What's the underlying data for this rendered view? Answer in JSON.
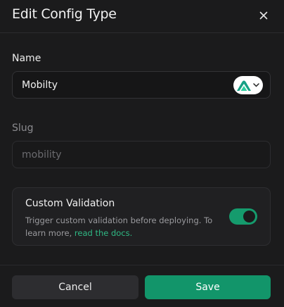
{
  "header": {
    "title": "Edit Config Type",
    "close_icon": "close-icon"
  },
  "form": {
    "name": {
      "label": "Name",
      "value": "Mobilty",
      "icon": "mountain-logo-icon",
      "icon_color": "#16a085"
    },
    "slug": {
      "label": "Slug",
      "value": "mobility"
    },
    "validation": {
      "title": "Custom Validation",
      "description": "Trigger custom validation before deploying. To learn more,",
      "link_text": "read the docs.",
      "enabled": true
    }
  },
  "footer": {
    "cancel_label": "Cancel",
    "save_label": "Save"
  },
  "colors": {
    "background": "#1b1b1c",
    "accent": "#12956a",
    "link": "#2fb884"
  }
}
